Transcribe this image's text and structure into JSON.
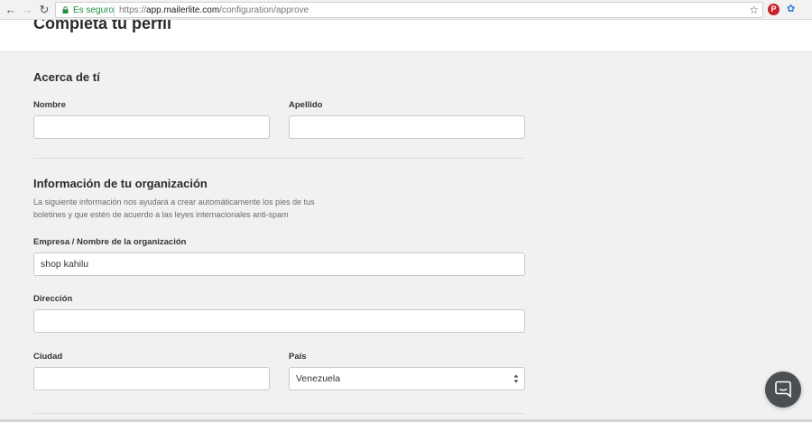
{
  "browser": {
    "secure_label": "Es seguro",
    "url_scheme": "https://",
    "url_host": "app.mailerlite.com",
    "url_path": "/configuration/approve",
    "pinterest_glyph": "P"
  },
  "page": {
    "title": "Completa tu perfil"
  },
  "about": {
    "title": "Acerca de tí",
    "first_name_label": "Nombre",
    "first_name_value": "",
    "last_name_label": "Apellido",
    "last_name_value": ""
  },
  "organization": {
    "title": "Información de tu organización",
    "description": "La siguiente información nos ayudará a crear automáticamente los pies de tus boletines y que estén de acuerdo a las leyes internacionales anti-spam",
    "company_label": "Empresa / Nombre de la organización",
    "company_value": "shop kahilu",
    "address_label": "Dirección",
    "address_value": "",
    "city_label": "Ciudad",
    "city_value": "",
    "country_label": "País",
    "country_value": "Venezuela"
  },
  "icons": {
    "back": "back-arrow-icon",
    "forward": "forward-arrow-icon",
    "reload": "reload-icon",
    "lock": "lock-icon",
    "star": "star-icon",
    "chat": "chat-icon"
  },
  "colors": {
    "secure_green": "#1e8e3e",
    "page_bg": "#f1f1f1",
    "chat_bg": "#4a4f54",
    "pinterest_red": "#cb2027"
  }
}
